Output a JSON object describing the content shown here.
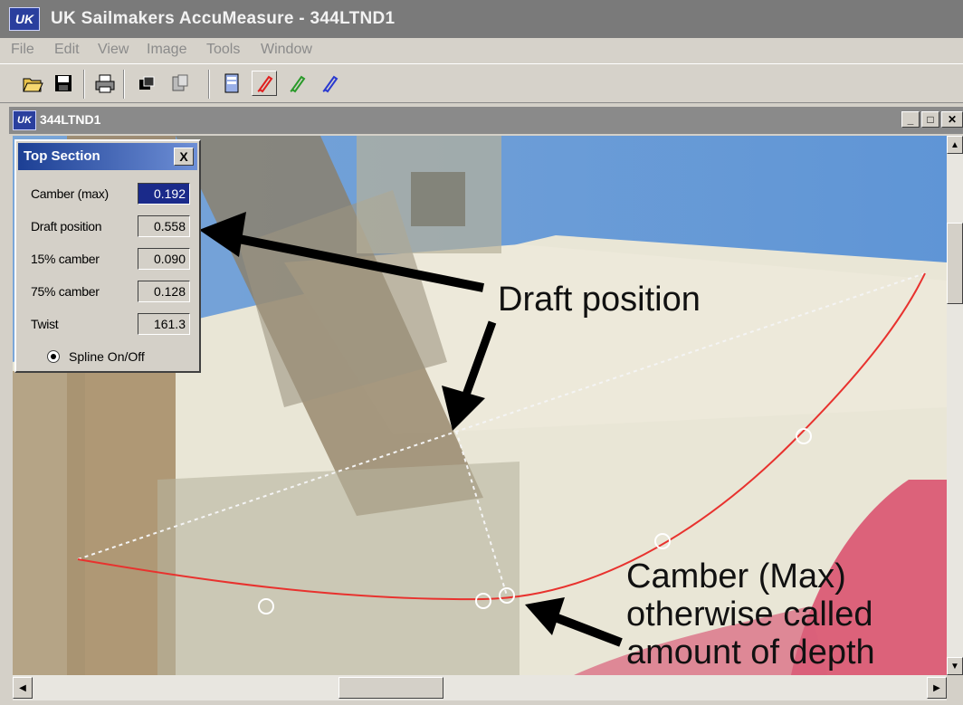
{
  "app": {
    "logo": "UK",
    "title": "UK Sailmakers AccuMeasure - 344LTND1"
  },
  "menu": [
    "File",
    "Edit",
    "View",
    "Image",
    "Tools",
    "Window"
  ],
  "toolbar": {
    "icons": [
      "open-folder-icon",
      "save-icon",
      "print-icon",
      "copy-icon",
      "paste-icon",
      "document-icon",
      "pen-red-icon",
      "pen-green-icon",
      "pen-blue-icon"
    ]
  },
  "document_window": {
    "logo": "UK",
    "title": "344LTND1"
  },
  "panel": {
    "title": "Top Section",
    "close": "X",
    "fields": [
      {
        "label": "Camber (max)",
        "value": "0.192",
        "selected": true
      },
      {
        "label": "Draft position",
        "value": "0.558",
        "selected": false
      },
      {
        "label": "15% camber",
        "value": "0.090",
        "selected": false
      },
      {
        "label": "75% camber",
        "value": "0.128",
        "selected": false
      },
      {
        "label": "Twist",
        "value": "161.3",
        "selected": false
      }
    ],
    "spline_label": "Spline On/Off"
  },
  "annotations": {
    "draft": "Draft position",
    "camber_lines": [
      "Camber (Max)",
      "otherwise called",
      "amount of depth"
    ]
  },
  "colors": {
    "curve": "#e8322e",
    "sky": "#6f9fd6",
    "sail": "#ece8d8"
  }
}
